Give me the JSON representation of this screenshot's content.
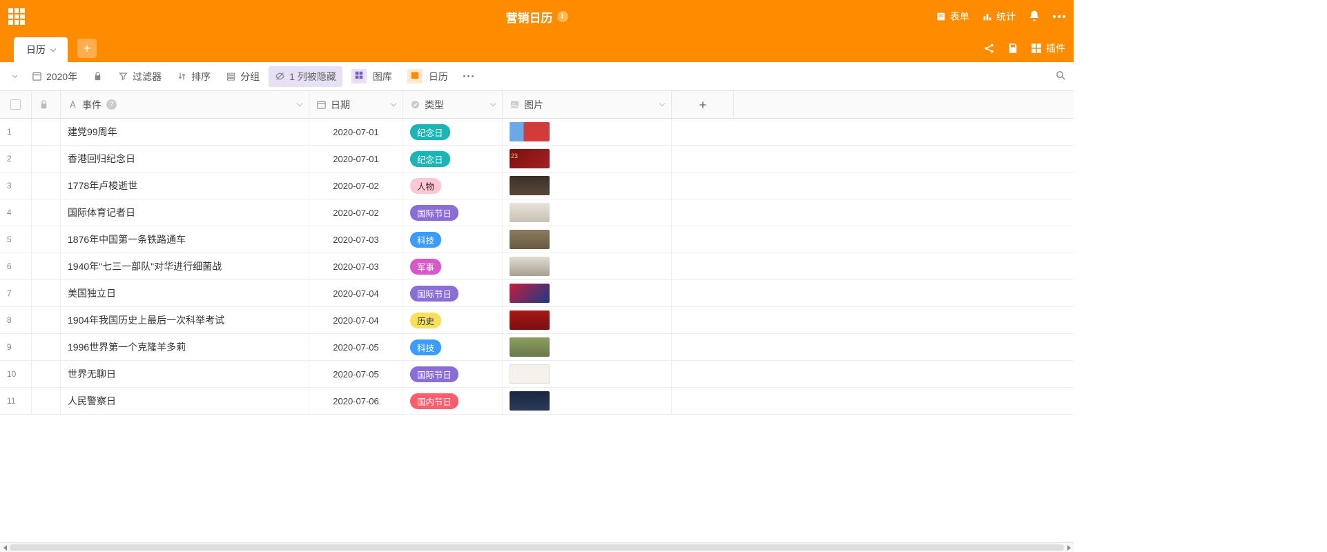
{
  "header": {
    "title": "营销日历",
    "form_btn": "表单",
    "stats_btn": "统计",
    "plugin_btn": "插件"
  },
  "tabs": {
    "active": "日历"
  },
  "toolbar": {
    "year": "2020年",
    "filter": "过滤器",
    "sort": "排序",
    "group": "分组",
    "hidden": "1 列被隐藏",
    "gallery": "图库",
    "calendar": "日历"
  },
  "columns": {
    "event": "事件",
    "date": "日期",
    "type": "类型",
    "image": "图片"
  },
  "rows": [
    {
      "num": "1",
      "event": "建党99周年",
      "date": "2020-07-01",
      "type": "纪念日",
      "type_class": "tag-memorial",
      "thumb_class": "thumb-1"
    },
    {
      "num": "2",
      "event": "香港回归纪念日",
      "date": "2020-07-01",
      "type": "纪念日",
      "type_class": "tag-memorial",
      "thumb_class": "thumb-2"
    },
    {
      "num": "3",
      "event": "1778年卢梭逝世",
      "date": "2020-07-02",
      "type": "人物",
      "type_class": "tag-person",
      "thumb_class": "thumb-3"
    },
    {
      "num": "4",
      "event": "国际体育记者日",
      "date": "2020-07-02",
      "type": "国际节日",
      "type_class": "tag-intl",
      "thumb_class": "thumb-4"
    },
    {
      "num": "5",
      "event": "1876年中国第一条铁路通车",
      "date": "2020-07-03",
      "type": "科技",
      "type_class": "tag-tech",
      "thumb_class": "thumb-5"
    },
    {
      "num": "6",
      "event": "1940年\"七三一部队\"对华进行细菌战",
      "date": "2020-07-03",
      "type": "军事",
      "type_class": "tag-military",
      "thumb_class": "thumb-6"
    },
    {
      "num": "7",
      "event": "美国独立日",
      "date": "2020-07-04",
      "type": "国际节日",
      "type_class": "tag-intl",
      "thumb_class": "thumb-7"
    },
    {
      "num": "8",
      "event": "1904年我国历史上最后一次科举考试",
      "date": "2020-07-04",
      "type": "历史",
      "type_class": "tag-history",
      "thumb_class": "thumb-8"
    },
    {
      "num": "9",
      "event": "1996世界第一个克隆羊多莉",
      "date": "2020-07-05",
      "type": "科技",
      "type_class": "tag-tech",
      "thumb_class": "thumb-9"
    },
    {
      "num": "10",
      "event": "世界无聊日",
      "date": "2020-07-05",
      "type": "国际节日",
      "type_class": "tag-intl",
      "thumb_class": "thumb-10"
    },
    {
      "num": "11",
      "event": "人民警察日",
      "date": "2020-07-06",
      "type": "国内节日",
      "type_class": "tag-domestic",
      "thumb_class": "thumb-11"
    }
  ]
}
